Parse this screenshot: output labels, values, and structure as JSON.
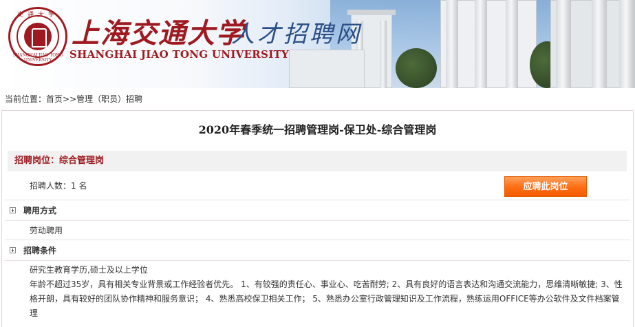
{
  "header": {
    "logo_cn": "上海交通大学",
    "logo_cn_suffix": "人才招聘网",
    "logo_en": "SHANGHAI JIAO TONG UNIVERSITY",
    "seal_top": "交通大学",
    "seal_bottom": "SHANGHAI JIAO TONG UNIVERSITY",
    "brand_color": "#9e1a20"
  },
  "breadcrumb": {
    "prefix": "当前位置：",
    "home": "首页",
    "sep": ">>",
    "category": "管理（职员）招聘"
  },
  "job": {
    "title": "2020年春季统一招聘管理岗-保卫处-综合管理岗",
    "post_label": "招聘岗位：综合管理岗",
    "headcount": "招聘人数：1 名",
    "apply_button": "应聘此岗位",
    "sections": [
      {
        "heading": "聘用方式",
        "body": [
          "劳动聘用"
        ]
      },
      {
        "heading": "招聘条件",
        "body": [
          "研究生教育学历,硕士及以上学位",
          "年龄不超过35岁，具有相关专业背景或工作经验者优先。 1、有较强的责任心、事业心、吃苦耐劳; 2、具有良好的语言表达和沟通交流能力，思维清晰敏捷; 3、性格开朗，具有较好的团队协作精神和服务意识； 4、熟悉高校保卫相关工作； 5、熟悉办公室行政管理知识及工作流程，熟练运用OFFICE等办公软件及文件档案管理"
        ]
      }
    ],
    "accent_color": "#ff6f16"
  }
}
